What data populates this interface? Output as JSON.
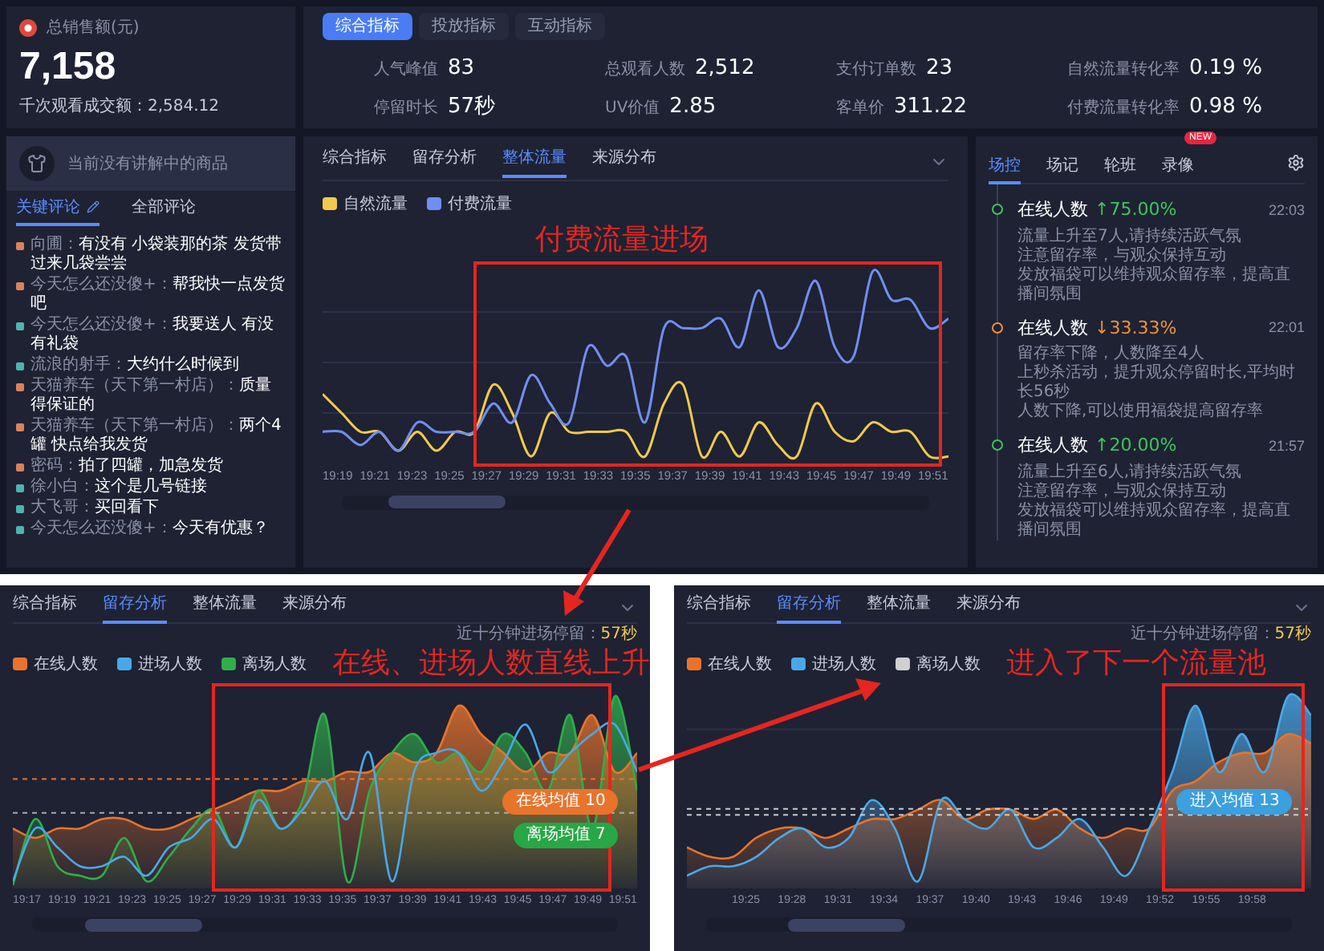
{
  "sales": {
    "label": "总销售额(元)",
    "value": "7,158",
    "sub": "千次观看成交额：2,584.12"
  },
  "metrics": {
    "tabs": [
      {
        "label": "综合指标",
        "selected": true
      },
      {
        "label": "投放指标",
        "selected": false
      },
      {
        "label": "互动指标",
        "selected": false
      }
    ],
    "items": [
      {
        "label": "人气峰值",
        "value": "83"
      },
      {
        "label": "总观看人数",
        "value": "2,512"
      },
      {
        "label": "支付订单数",
        "value": "23"
      },
      {
        "label": "自然流量转化率",
        "value": "0.19 %"
      },
      {
        "label": "停留时长",
        "value": "57秒"
      },
      {
        "label": "UV价值",
        "value": "2.85"
      },
      {
        "label": "客单价",
        "value": "311.22"
      },
      {
        "label": "付费流量转化率",
        "value": "0.98 %"
      }
    ]
  },
  "product": {
    "text": "当前没有讲解中的商品"
  },
  "comments": {
    "tabs": [
      {
        "label": "关键评论",
        "selected": true
      },
      {
        "label": "全部评论",
        "selected": false
      }
    ],
    "items": [
      {
        "user": "向圃：",
        "text": "有没有 小袋装那的茶 发货带过来几袋尝尝",
        "color": "#d9825b"
      },
      {
        "user": "今天怎么还没傻+：",
        "text": "帮我快一点发货吧",
        "color": "#d9825b"
      },
      {
        "user": "今天怎么还没傻+：",
        "text": "我要送人 有没有礼袋",
        "color": "#4fb3b0"
      },
      {
        "user": "流浪的射手：",
        "text": "大约什么时候到",
        "color": "#4fb3b0"
      },
      {
        "user": "天猫养车（天下第一村店）：",
        "text": "质量得保证的",
        "color": "#d9825b"
      },
      {
        "user": "天猫养车（天下第一村店）：",
        "text": "两个4罐 快点给我发货",
        "color": "#d9825b"
      },
      {
        "user": "密码：",
        "text": "拍了四罐，加急发货",
        "color": "#d9825b"
      },
      {
        "user": "徐小白：",
        "text": "这个是几号链接",
        "color": "#4fb3b0"
      },
      {
        "user": "大飞哥：",
        "text": "买回看下",
        "color": "#4fb3b0"
      },
      {
        "user": "今天怎么还没傻+：",
        "text": "今天有优惠？",
        "color": "#4fb3b0"
      }
    ]
  },
  "flow_chart": {
    "kind": "flow",
    "tabs": [
      {
        "label": "综合指标",
        "selected": false
      },
      {
        "label": "留存分析",
        "selected": false
      },
      {
        "label": "整体流量",
        "selected": true
      },
      {
        "label": "来源分布",
        "selected": false
      }
    ],
    "legend": [
      {
        "label": "自然流量",
        "color": "#f2c94c"
      },
      {
        "label": "付费流量",
        "color": "#6f8ff0"
      }
    ],
    "annotation": "付费流量进场",
    "x_labels": [
      "19:19",
      "19:21",
      "19:23",
      "19:25",
      "19:27",
      "19:29",
      "19:31",
      "19:33",
      "19:35",
      "19:37",
      "19:39",
      "19:41",
      "19:43",
      "19:45",
      "19:47",
      "19:49",
      "19:51"
    ]
  },
  "monitor": {
    "tabs": [
      {
        "label": "场控",
        "selected": true
      },
      {
        "label": "场记",
        "selected": false
      },
      {
        "label": "轮班",
        "selected": false
      },
      {
        "label": "录像",
        "selected": false,
        "badge": "NEW"
      }
    ],
    "events": [
      {
        "title": "在线人数",
        "change": "↑75.00%",
        "color": "#3fc45b",
        "time": "22:03",
        "lines": [
          "流量上升至7人,请持续活跃气氛",
          "注意留存率，与观众保持互动",
          "发放福袋可以维持观众留存率，提高直播间氛围"
        ]
      },
      {
        "title": "在线人数",
        "change": "↓33.33%",
        "color": "#f0903a",
        "time": "22:01",
        "lines": [
          "留存率下降，人数降至4人",
          "上秒杀活动，提升观众停留时长,平均时长56秒",
          "人数下降,可以使用福袋提高留存率"
        ]
      },
      {
        "title": "在线人数",
        "change": "↑20.00%",
        "color": "#3fc45b",
        "time": "21:57",
        "lines": [
          "流量上升至6人,请持续活跃气氛",
          "注意留存率，与观众保持互动",
          "发放福袋可以维持观众留存率，提高直播间氛围"
        ]
      }
    ]
  },
  "bottom_panels": [
    {
      "kind": "retention",
      "tabs": [
        {
          "label": "综合指标",
          "selected": false
        },
        {
          "label": "留存分析",
          "selected": true
        },
        {
          "label": "整体流量",
          "selected": false
        },
        {
          "label": "来源分布",
          "selected": false
        }
      ],
      "note": "近十分钟进场停留：",
      "note_value": "57秒",
      "legend": [
        {
          "label": "在线人数",
          "color": "#e8742c"
        },
        {
          "label": "进场人数",
          "color": "#4aa8e8"
        },
        {
          "label": "离场人数",
          "color": "#2fae4a"
        }
      ],
      "annotation": "在线、进场人数直线上升",
      "badges": [
        {
          "label": "在线均值 10",
          "color": "#e8742c"
        },
        {
          "label": "离场均值 7",
          "color": "#27a745"
        }
      ],
      "x_labels": [
        "19:17",
        "19:19",
        "19:21",
        "19:23",
        "19:25",
        "19:27",
        "19:29",
        "19:31",
        "19:33",
        "19:35",
        "19:37",
        "19:39",
        "19:41",
        "19:43",
        "19:45",
        "19:47",
        "19:49",
        "19:51"
      ]
    },
    {
      "kind": "pool",
      "tabs": [
        {
          "label": "综合指标",
          "selected": false
        },
        {
          "label": "留存分析",
          "selected": true
        },
        {
          "label": "整体流量",
          "selected": false
        },
        {
          "label": "来源分布",
          "selected": false
        }
      ],
      "note": "近十分钟进场停留：",
      "note_value": "57秒",
      "legend": [
        {
          "label": "在线人数",
          "color": "#e8742c"
        },
        {
          "label": "进场人数",
          "color": "#4aa8e8"
        },
        {
          "label": "离场人数",
          "color": "#d0d0d0"
        }
      ],
      "annotation": "进入了下一个流量池",
      "badges": [
        {
          "label": "进入均值 13",
          "color": "#3aa0e0"
        }
      ],
      "x_labels": [
        "19:25",
        "19:28",
        "19:31",
        "19:34",
        "19:37",
        "19:40",
        "19:43",
        "19:46",
        "19:49",
        "19:52",
        "19:55",
        "19:58"
      ]
    }
  ]
}
